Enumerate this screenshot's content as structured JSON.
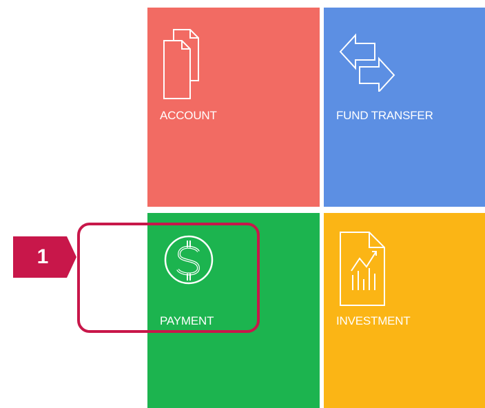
{
  "tiles": [
    {
      "id": "account",
      "label": "ACCOUNT",
      "color": "#f26b63",
      "icon": "documents-icon"
    },
    {
      "id": "fund-transfer",
      "label": "FUND TRANSFER",
      "color": "#5c8fe3",
      "icon": "transfer-arrows-icon"
    },
    {
      "id": "payment",
      "label": "PAYMENT",
      "color": "#1cb44f",
      "icon": "dollar-icon"
    },
    {
      "id": "investment",
      "label": "INVESTMENT",
      "color": "#fbb515",
      "icon": "chart-document-icon"
    }
  ],
  "annotation": {
    "step_number": "1",
    "marker_color": "#c8174a",
    "target": "payment"
  }
}
